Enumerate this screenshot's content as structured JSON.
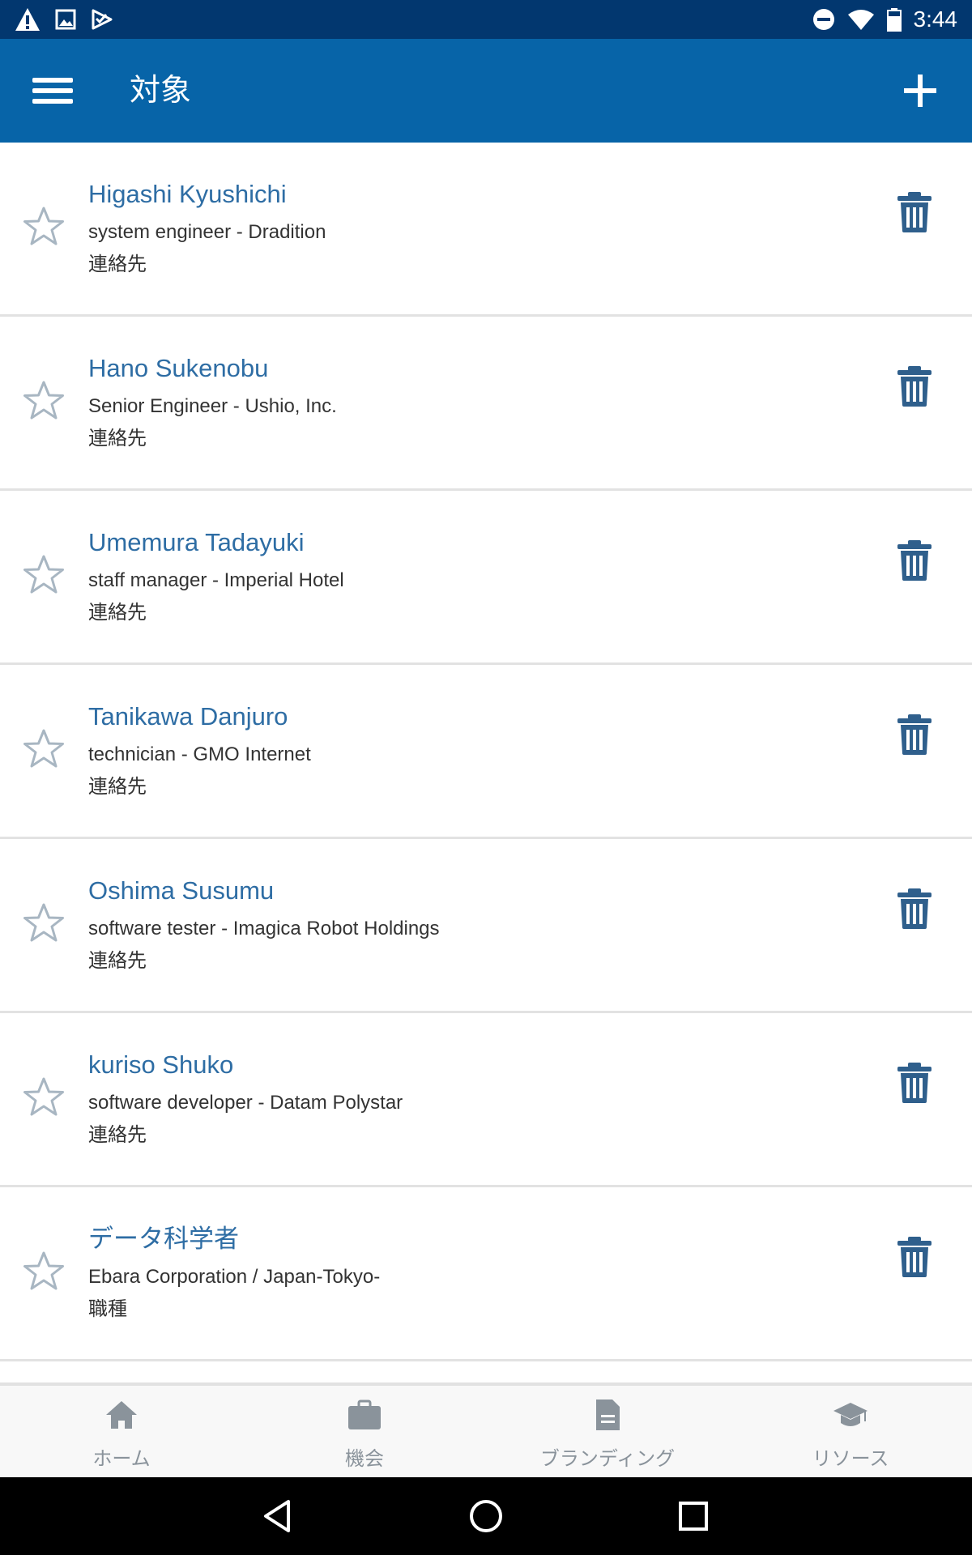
{
  "status_bar": {
    "time": "3:44",
    "icons": [
      "warning-icon",
      "image-icon",
      "check-flag-icon",
      "dnd-icon",
      "wifi-icon",
      "battery-icon"
    ]
  },
  "app_bar": {
    "title": "対象",
    "menu_icon": "hamburger-menu-icon",
    "add_icon": "plus-icon"
  },
  "items": [
    {
      "name": "Higashi Kyushichi",
      "subtitle": "system engineer - Dradition",
      "type": "連絡先"
    },
    {
      "name": "Hano Sukenobu",
      "subtitle": "Senior Engineer - Ushio, Inc.",
      "type": "連絡先"
    },
    {
      "name": "Umemura Tadayuki",
      "subtitle": "staff manager - Imperial Hotel",
      "type": "連絡先"
    },
    {
      "name": "Tanikawa Danjuro",
      "subtitle": "technician - GMO Internet",
      "type": "連絡先"
    },
    {
      "name": "Oshima Susumu",
      "subtitle": "software tester - Imagica Robot Holdings",
      "type": "連絡先"
    },
    {
      "name": "kuriso Shuko",
      "subtitle": "software developer - Datam Polystar",
      "type": "連絡先"
    },
    {
      "name": "データ科学者",
      "subtitle": "Ebara Corporation / Japan-Tokyo-",
      "type": "職種"
    }
  ],
  "bottom_nav": {
    "items": [
      {
        "label": "ホーム",
        "icon": "home-icon"
      },
      {
        "label": "機会",
        "icon": "briefcase-icon"
      },
      {
        "label": "ブランディング",
        "icon": "document-icon"
      },
      {
        "label": "リソース",
        "icon": "graduation-cap-icon"
      }
    ]
  },
  "colors": {
    "status_bar": "#02376f",
    "app_bar": "#0764a8",
    "name_text": "#2e6da4",
    "trash_icon": "#2f5f8c",
    "star_icon": "#a8b6c2",
    "nav_icon": "#8a939b"
  }
}
